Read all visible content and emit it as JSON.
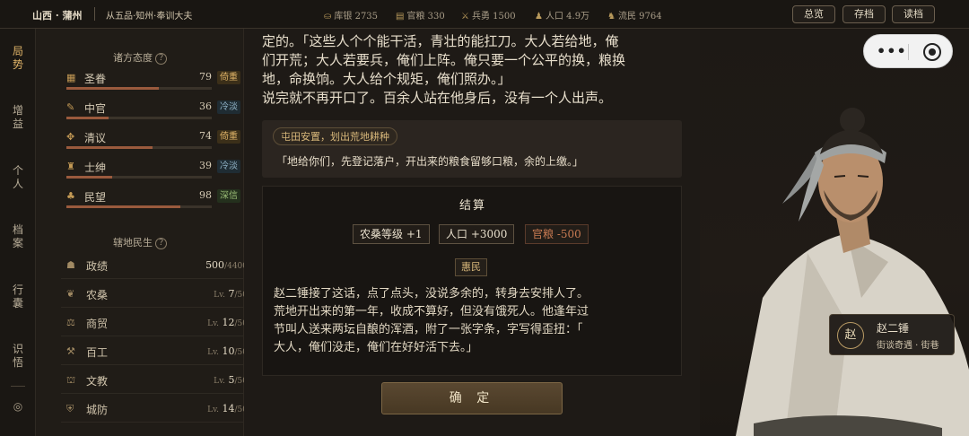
{
  "topbar": {
    "region": "山西 · 蒲州",
    "rank": "从五品·知州·奉训大夫",
    "stats": [
      {
        "icon": "treasury-icon",
        "glyph": "⛀",
        "label": "库银",
        "value": "2735"
      },
      {
        "icon": "grain-icon",
        "glyph": "▤",
        "label": "官粮",
        "value": "330"
      },
      {
        "icon": "soldier-icon",
        "glyph": "⚔",
        "label": "兵勇",
        "value": "1500"
      },
      {
        "icon": "population-icon",
        "glyph": "♟",
        "label": "人口",
        "value": "4.9万"
      },
      {
        "icon": "refugee-icon",
        "glyph": "♞",
        "label": "流民",
        "value": "9764"
      }
    ],
    "buttons": {
      "overview": "总览",
      "save": "存档",
      "load": "读档"
    }
  },
  "vnav": {
    "items": [
      "局势",
      "增益",
      "个人",
      "档案",
      "行囊",
      "识悟"
    ],
    "settings_glyph": "◎"
  },
  "factions": {
    "title": "诸方态度",
    "help": "?",
    "items": [
      {
        "icon": "scroll-icon",
        "glyph": "▦",
        "name": "圣眷",
        "value": "79",
        "tag": "倚重",
        "tag_type": "heavy",
        "level": 0.79
      },
      {
        "icon": "eunuch-icon",
        "glyph": "✎",
        "name": "中官",
        "value": "36",
        "tag": "冷淡",
        "tag_type": "cold",
        "level": 0.36
      },
      {
        "icon": "scholar-icon",
        "glyph": "✥",
        "name": "清议",
        "value": "74",
        "tag": "倚重",
        "tag_type": "heavy",
        "level": 0.74
      },
      {
        "icon": "gentry-icon",
        "glyph": "♜",
        "name": "士绅",
        "value": "39",
        "tag": "冷淡",
        "tag_type": "cold",
        "level": 0.39
      },
      {
        "icon": "people-icon",
        "glyph": "♣",
        "name": "民望",
        "value": "98",
        "tag": "深信",
        "tag_type": "trust",
        "level": 0.98
      }
    ]
  },
  "governance": {
    "title": "辖地民生",
    "help": "?",
    "items": [
      {
        "icon": "politics-icon",
        "glyph": "☗",
        "name": "政绩",
        "value": "500",
        "suffix": "/4400",
        "prefix": ""
      },
      {
        "icon": "farming-icon",
        "glyph": "❦",
        "name": "农桑",
        "value": "7",
        "suffix": "/50",
        "prefix": "Lv."
      },
      {
        "icon": "commerce-icon",
        "glyph": "⚖",
        "name": "商贸",
        "value": "12",
        "suffix": "/50",
        "prefix": "Lv."
      },
      {
        "icon": "craft-icon",
        "glyph": "⚒",
        "name": "百工",
        "value": "10",
        "suffix": "/50",
        "prefix": "Lv."
      },
      {
        "icon": "education-icon",
        "glyph": "⛫",
        "name": "文教",
        "value": "5",
        "suffix": "/50",
        "prefix": "Lv."
      },
      {
        "icon": "defense-icon",
        "glyph": "⛨",
        "name": "城防",
        "value": "14",
        "suffix": "/50",
        "prefix": "Lv."
      }
    ]
  },
  "story": {
    "lines": [
      "定的。「这些人个个能干活，青壮的能扛刀。大人若给地，俺",
      "们开荒；大人若要兵，俺们上阵。俺只要一个公平的换，粮换",
      "地，命换饷。大人给个规矩，俺们照办。」",
      "说完就不再开口了。百余人站在他身后，没有一个人出声。"
    ],
    "choice_tag": "屯田安置，划出荒地耕种",
    "choice_quote": "「地给你们，先登记落户，开出来的粮食留够口粮，余的上缴。」"
  },
  "settlement": {
    "title": "结算",
    "chips": [
      {
        "label": "农桑等级 +1",
        "kind": "pos"
      },
      {
        "label": "人口 +3000",
        "kind": "pos"
      },
      {
        "label": "官粮 -500",
        "kind": "neg"
      }
    ],
    "badge": "惠民",
    "text_lines": [
      "赵二锤接了这话，点了点头，没说多余的，转身去安排人了。",
      "荒地开出来的第一年，收成不算好，但没有饿死人。他逢年过",
      "节叫人送来两坛自酿的浑酒，附了一张字条，字写得歪扭：「",
      "大人，俺们没走，俺们在好好活下去。」"
    ],
    "confirm": "确 定"
  },
  "npc": {
    "seal": "赵",
    "name": "赵二锤",
    "title": "街谈奇遇 · 街巷"
  },
  "capsule": {
    "more": "•••"
  }
}
